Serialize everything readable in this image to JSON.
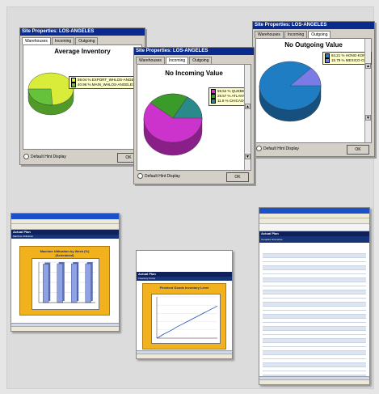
{
  "windows": {
    "inventory": {
      "title": "Site Properties: LOS-ANGELES",
      "tabs": [
        "Warehouses",
        "Incoming",
        "Outgoing"
      ],
      "active_tab": 0,
      "chart_title": "Average Inventory",
      "legend": [
        "59.04 % EXPORT_WHLOS-ANGELES",
        "40.96 % MAIN_WHLOS-ANGELES"
      ],
      "colors": [
        "#d9ec3a",
        "#66c23a"
      ],
      "default_hint": "Default Hint Display",
      "ok": "OK"
    },
    "incoming": {
      "title": "Site Properties: LOS-ANGELES",
      "tabs": [
        "Warehouses",
        "Incoming",
        "Outgoing"
      ],
      "active_tab": 1,
      "chart_title": "No Incoming Value",
      "legend": [
        "59.52 % QUEBEC",
        "28.57 % ATLANTA",
        "11.9 % CHICAGO"
      ],
      "colors": [
        "#cc33cc",
        "#3a9a2a",
        "#2a8a8a"
      ],
      "default_hint": "Default Hint Display",
      "ok": "OK"
    },
    "outgoing": {
      "title": "Site Properties: LOS-ANGELES",
      "tabs": [
        "Warehouses",
        "Incoming",
        "Outgoing"
      ],
      "active_tab": 2,
      "chart_title": "No Outgoing Value",
      "legend": [
        "84.21 % HONG-KONG",
        "15.79 % MEXICO-CITY"
      ],
      "colors": [
        "#1f7dc4",
        "#7b7be6"
      ],
      "default_hint": "Default Hint Display",
      "ok": "OK"
    }
  },
  "thumbnails": {
    "bar": {
      "header": "Actual Plan",
      "sub": "Machine Utilization",
      "chart_title": "Machine Utilization by Week (%) (Scheduled)",
      "chart_data": {
        "type": "bar",
        "categories": [
          "W1",
          "W2",
          "W3",
          "W4"
        ],
        "values": [
          95,
          96,
          96,
          96
        ],
        "ylim": [
          0,
          100
        ]
      }
    },
    "line": {
      "header": "Actual Plan",
      "sub": "Inventory Curve",
      "chart_title": "Finished Goods Inventory Level",
      "chart_data": {
        "type": "line",
        "values": [
          0,
          4,
          9,
          13,
          17,
          21,
          26,
          30,
          34,
          38,
          42,
          46,
          50,
          54,
          58,
          62,
          66,
          70,
          74,
          78
        ],
        "ylim": [
          0,
          100
        ]
      }
    },
    "report": {
      "header": "Actual Plan",
      "sub": "Compare Scenarios"
    }
  }
}
